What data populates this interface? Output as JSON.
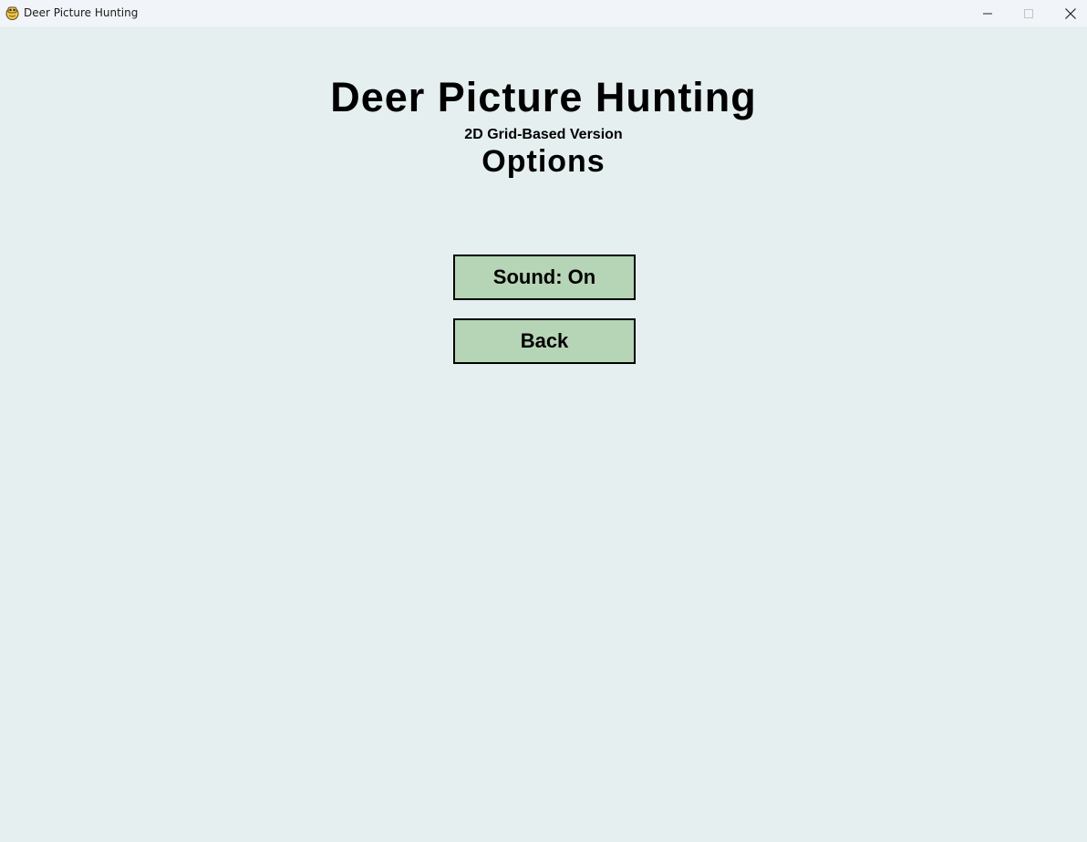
{
  "window": {
    "title": "Deer Picture Hunting",
    "icon": "pygame-snake-icon",
    "controls": [
      "minimize-icon",
      "maximize-icon",
      "close-icon"
    ]
  },
  "screen": {
    "title": "Deer Picture Hunting",
    "subtitle": "2D Grid-Based Version",
    "section": "Options"
  },
  "menu": {
    "sound_label": "Sound: On",
    "back_label": "Back"
  },
  "colors": {
    "background": "#e6eff0",
    "button_fill": "#b6d4b6",
    "button_border": "#000000",
    "titlebar": "#f1f5f9"
  }
}
